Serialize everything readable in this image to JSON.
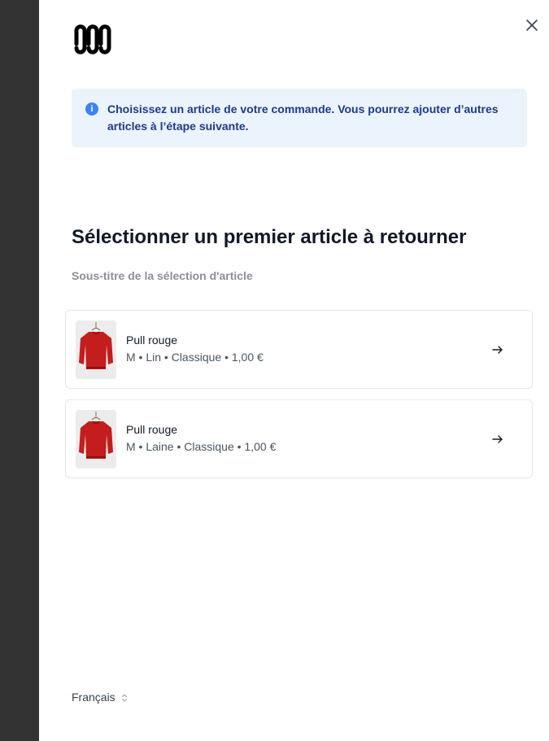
{
  "brand": {
    "logo_icon": "brand-logo"
  },
  "header": {
    "close_icon": "close-icon"
  },
  "info_banner": {
    "icon": "info-icon",
    "icon_glyph": "i",
    "text": "Choisissez un article de votre commande. Vous pourrez ajouter d’autres articles à l’étape suivante.",
    "background_color": "#ebf3fd",
    "text_color": "#1e3a8a",
    "icon_color": "#3b82f6"
  },
  "main": {
    "title": "Sélectionner un premier article à retourner",
    "subtitle": "Sous-titre de la sélection d'article"
  },
  "items": [
    {
      "name": "Pull rouge",
      "meta": "M • Lin • Classique • 1,00 €",
      "thumbnail": "red-sweater-image",
      "action_icon": "arrow-right-icon"
    },
    {
      "name": "Pull rouge",
      "meta": "M • Laine • Classique • 1,00 €",
      "thumbnail": "red-sweater-image",
      "action_icon": "arrow-right-icon"
    }
  ],
  "footer": {
    "language": "Français",
    "language_icon": "chevron-up-down-icon"
  },
  "colors": {
    "sidebar": "#333333",
    "sweater": "#c41d1d"
  }
}
